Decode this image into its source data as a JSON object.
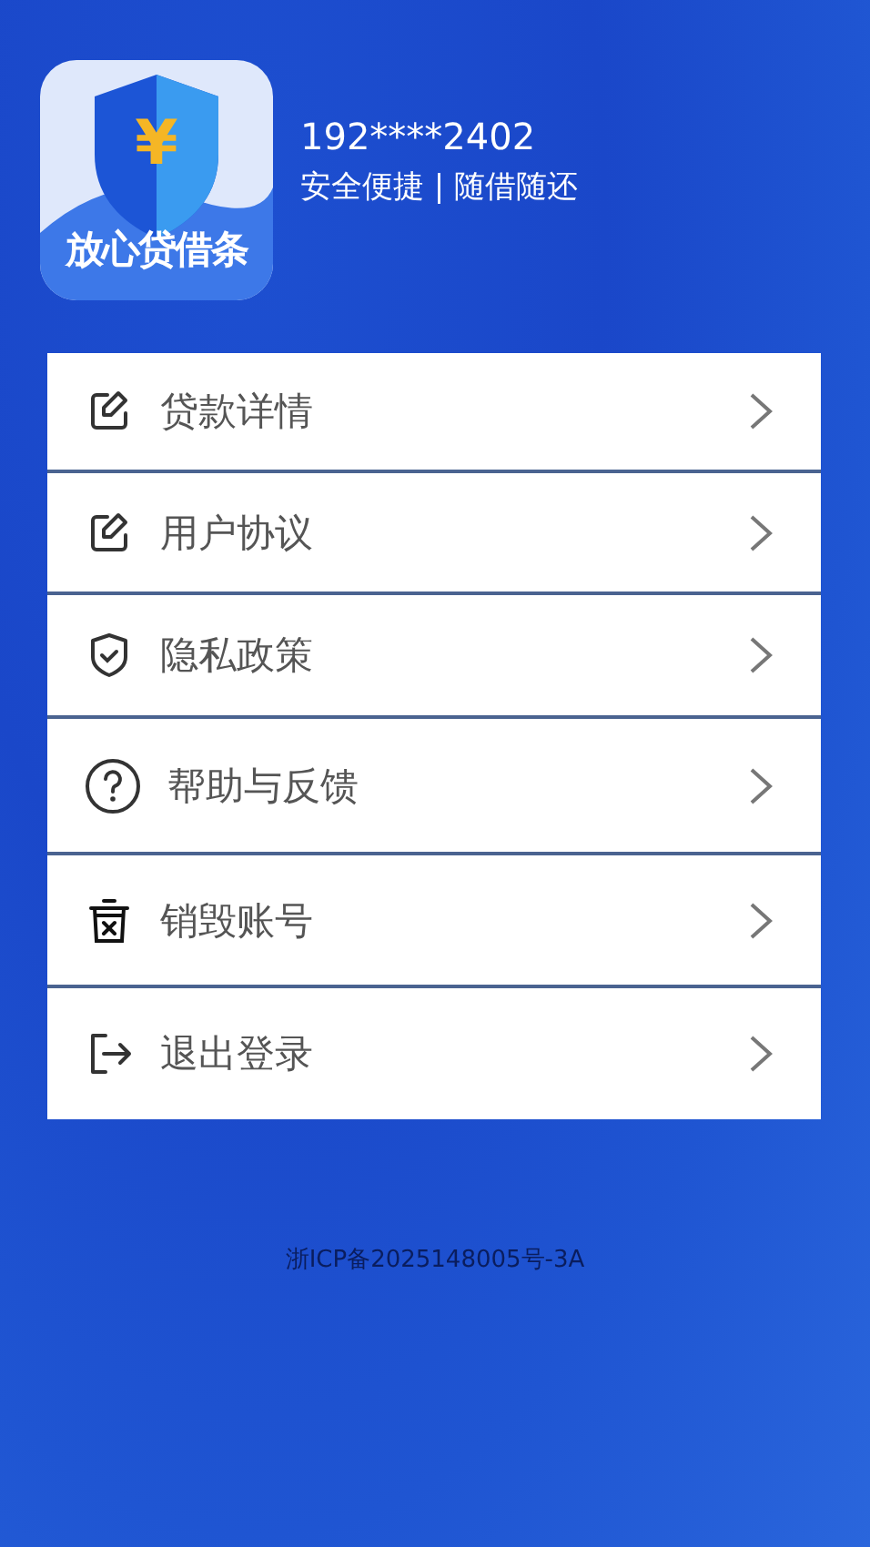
{
  "app_logo": {
    "text": "放心贷借条",
    "symbol": "¥"
  },
  "profile": {
    "phone": "192****2402",
    "slogan": "安全便捷 | 随借随还"
  },
  "menu": [
    {
      "label": "贷款详情",
      "kind": "edit"
    },
    {
      "label": "用户协议",
      "kind": "edit"
    },
    {
      "label": "隐私政策",
      "kind": "shield"
    },
    {
      "label": "帮助与反馈",
      "kind": "help"
    },
    {
      "label": "销毁账号",
      "kind": "trash"
    },
    {
      "label": "退出登录",
      "kind": "logout"
    }
  ],
  "footer": {
    "icp": "浙ICP备2025148005号-3A"
  }
}
